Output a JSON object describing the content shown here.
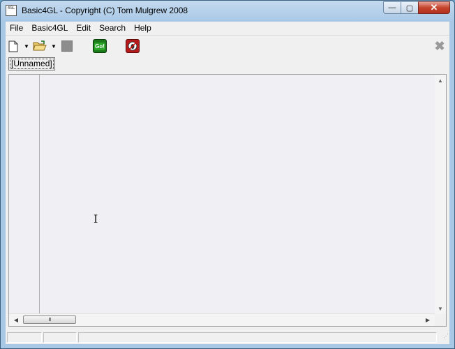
{
  "window": {
    "title": "Basic4GL - Copyright (C) Tom Mulgrew 2008",
    "app_icon_text": "4GL",
    "minimize_glyph": "—",
    "maximize_glyph": "▢",
    "close_glyph": "✕"
  },
  "menu": {
    "items": [
      {
        "label": "File"
      },
      {
        "label": "Basic4GL"
      },
      {
        "label": "Edit"
      },
      {
        "label": "Search"
      },
      {
        "label": "Help"
      }
    ]
  },
  "toolbar": {
    "go_label": "Go!",
    "icons": {
      "new": "new-file-icon",
      "open": "open-folder-icon",
      "stop": "stop-icon",
      "go": "go-icon",
      "debug": "debug-icon",
      "close": "close-icon"
    },
    "close_glyph": "✖"
  },
  "tabs": [
    {
      "label": "[Unnamed]"
    }
  ],
  "editor": {
    "hscroll_thumb_grip": "III",
    "up_glyph": "▲",
    "down_glyph": "▼",
    "left_glyph": "◀",
    "right_glyph": "▶"
  },
  "cursor_glyph": "I",
  "colors": {
    "editor_bg": "#f0f0f4",
    "go_green": "#1a7a1a",
    "debug_red": "#b61a1a",
    "close_red": "#c5442c"
  }
}
